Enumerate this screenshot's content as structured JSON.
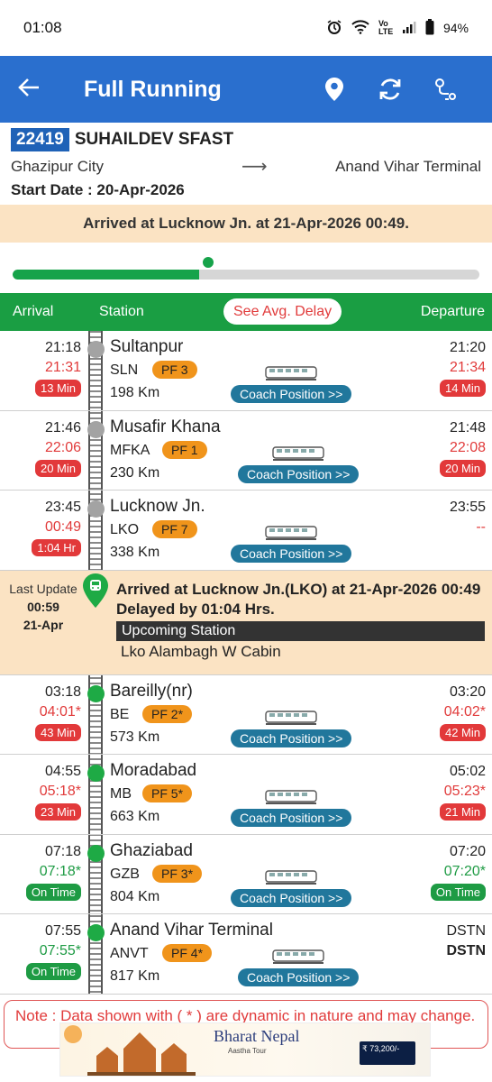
{
  "status_bar": {
    "time": "01:08",
    "battery": "94%",
    "volte": "Vo LTE"
  },
  "app_bar": {
    "title": "Full Running",
    "icons": [
      "back-arrow-icon",
      "location-pin-icon",
      "refresh-icon",
      "route-icon"
    ]
  },
  "train": {
    "number": "22419",
    "name": "SUHAILDEV SFAST",
    "from": "Ghazipur City",
    "to": "Anand Vihar Terminal",
    "start_date": "Start Date : 20-Apr-2026",
    "status": "Arrived at Lucknow Jn. at 21-Apr-2026 00:49.",
    "progress_fraction": 0.4
  },
  "columns": {
    "arrival": "Arrival",
    "station": "Station",
    "avg_delay": "See Avg. Delay",
    "departure": "Departure"
  },
  "coach_label": "Coach Position >>",
  "stations_before": [
    {
      "name": "Sultanpur",
      "code": "SLN",
      "pf": "PF 3",
      "km": "198 Km",
      "arr": "21:18",
      "arr_act": "21:31",
      "arr_badge": "13 Min",
      "dep": "21:20",
      "dep_act": "21:34",
      "dep_badge": "14 Min"
    },
    {
      "name": "Musafir Khana",
      "code": "MFKA",
      "pf": "PF 1",
      "km": "230 Km",
      "arr": "21:46",
      "arr_act": "22:06",
      "arr_badge": "20 Min",
      "dep": "21:48",
      "dep_act": "22:08",
      "dep_badge": "20 Min"
    },
    {
      "name": "Lucknow Jn.",
      "code": "LKO",
      "pf": "PF 7",
      "km": "338 Km",
      "arr": "23:45",
      "arr_act": "00:49",
      "arr_badge": "1:04 Hr",
      "dep": "23:55",
      "dep_act": "--",
      "dep_badge": ""
    }
  ],
  "live": {
    "last_update_label": "Last Update",
    "last_update_time": "00:59",
    "last_update_date": "21-Apr",
    "message": "Arrived at Lucknow Jn.(LKO) at 21-Apr-2026 00:49 Delayed by 01:04 Hrs.",
    "upcoming_label": "Upcoming Station",
    "upcoming_station": "Lko Alambagh W Cabin"
  },
  "stations_after": [
    {
      "name": "Bareilly(nr)",
      "code": "BE",
      "pf": "PF 2*",
      "km": "573 Km",
      "arr": "03:18",
      "arr_act": "04:01*",
      "arr_badge": "43 Min",
      "dep": "03:20",
      "dep_act": "04:02*",
      "dep_badge": "42 Min"
    },
    {
      "name": "Moradabad",
      "code": "MB",
      "pf": "PF 5*",
      "km": "663 Km",
      "arr": "04:55",
      "arr_act": "05:18*",
      "arr_badge": "23 Min",
      "dep": "05:02",
      "dep_act": "05:23*",
      "dep_badge": "21 Min"
    },
    {
      "name": "Ghaziabad",
      "code": "GZB",
      "pf": "PF 3*",
      "km": "804 Km",
      "arr": "07:18",
      "arr_act": "07:18*",
      "arr_badge": "On Time",
      "dep": "07:20",
      "dep_act": "07:20*",
      "dep_badge": "On Time"
    },
    {
      "name": "Anand Vihar Terminal",
      "code": "ANVT",
      "pf": "PF 4*",
      "km": "817 Km",
      "arr": "07:55",
      "arr_act": "07:55*",
      "arr_badge": "On Time",
      "dep": "DSTN",
      "dep_act": "DSTN",
      "dep_badge": ""
    }
  ],
  "note": "Note : Data shown with ( * ) are dynamic in nature and may change.",
  "ad": {
    "brand": "Bharat Nepal",
    "subtitle": "Aastha Tour",
    "price": "₹ 73,200/-"
  },
  "colors": {
    "primary": "#2a6fce",
    "green": "#1a9e43",
    "late": "#e13b3b",
    "platform": "#f0941b",
    "coach": "#21779c",
    "banner": "#fbe3c3"
  }
}
